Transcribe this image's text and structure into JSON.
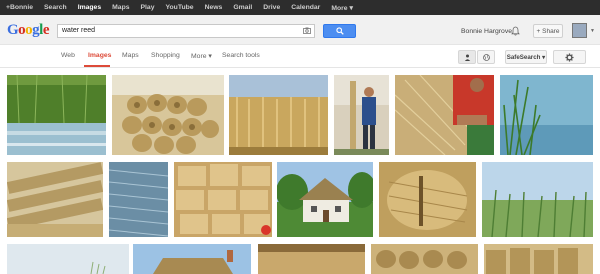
{
  "gbar": {
    "links": [
      "+Bonnie",
      "Search",
      "Images",
      "Maps",
      "Play",
      "YouTube",
      "News",
      "Gmail",
      "Drive",
      "Calendar",
      "More ▾"
    ],
    "active_index": 2
  },
  "header": {
    "logo": "Google",
    "query": "water reed",
    "user_name": "Bonnie Hargrove",
    "share_label": "+ Share"
  },
  "nav": {
    "items": [
      "Web",
      "Images",
      "Maps",
      "Shopping",
      "More ▾",
      "Search tools"
    ],
    "active_index": 1,
    "safesearch_label": "SafeSearch ▾"
  },
  "results": {
    "images": [
      "green reed marsh",
      "bundled thatching reed",
      "bundled reeds field",
      "man with reed bundle",
      "hands weaving reeds",
      "green reeds in water",
      "bundled reeds",
      "reed closeup",
      "stacked reed bundles",
      "thatched cottage",
      "reed bundle closeup",
      "green reeds sky",
      "reed shore",
      "thatched roof house",
      "reed bale",
      "reed bundles stack",
      "reed bundles row"
    ]
  },
  "colors": {
    "accent": "#dd4b39",
    "search_blue": "#4d8ef1",
    "bar": "#2d2d2d"
  }
}
